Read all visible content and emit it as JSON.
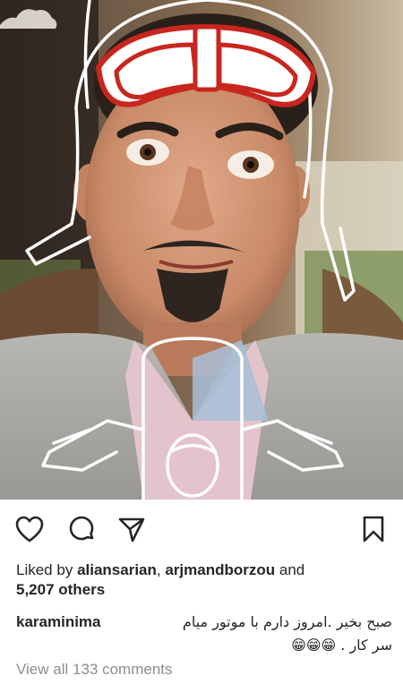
{
  "post": {
    "liked_by_prefix": "Liked by",
    "liked_user_1": "aliansarian",
    "separator": ",",
    "liked_user_2": "arjmandborzou",
    "and": "and",
    "others_count": "5,207 others",
    "caption_user": "karaminima",
    "caption_text": "صبح بخیر .امروز دارم با موتور میام سر کار .",
    "caption_emoji": "😁😁😁",
    "view_comments": "View all 133 comments"
  },
  "icons": {
    "like": "heart-icon",
    "comment": "comment-bubble-icon",
    "share": "paper-plane-icon",
    "save": "bookmark-icon"
  },
  "colors": {
    "helmet_red": "#c8261e",
    "text_primary": "#262626",
    "text_secondary": "#8e8e8e"
  }
}
